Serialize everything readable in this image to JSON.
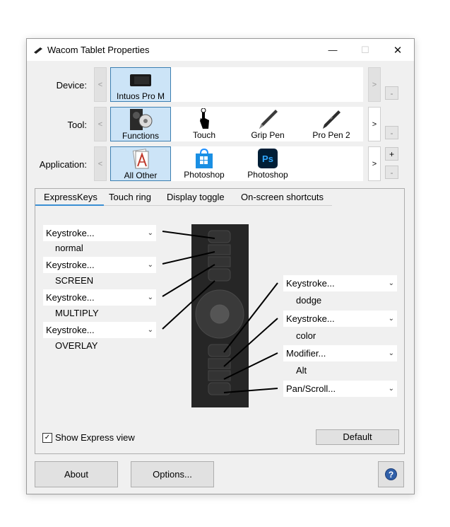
{
  "window": {
    "title": "Wacom Tablet Properties"
  },
  "titlebar": {
    "minimize": "—",
    "maximize": "☐",
    "close": "✕"
  },
  "rows": {
    "device": {
      "label": "Device:",
      "prev": "<",
      "next": ">",
      "minus": "-",
      "tiles": [
        {
          "label": "Intuos Pro M",
          "icon": "tablet-icon"
        }
      ]
    },
    "tool": {
      "label": "Tool:",
      "prev": "<",
      "next": ">",
      "minus": "-",
      "tiles": [
        {
          "label": "Functions",
          "icon": "functions-icon"
        },
        {
          "label": "Touch",
          "icon": "touch-hand-icon"
        },
        {
          "label": "Grip Pen",
          "icon": "grip-pen-icon"
        },
        {
          "label": "Pro Pen 2",
          "icon": "pro-pen-icon"
        }
      ]
    },
    "application": {
      "label": "Application:",
      "prev": "<",
      "next": ">",
      "plus": "+",
      "minus": "-",
      "tiles": [
        {
          "label": "All Other",
          "icon": "all-other-apps-icon"
        },
        {
          "label": "Photoshop",
          "icon": "windows-store-photoshop-icon"
        },
        {
          "label": "Photoshop",
          "icon": "photoshop-icon"
        }
      ]
    }
  },
  "tabs": [
    "ExpressKeys",
    "Touch ring",
    "Display toggle",
    "On-screen shortcuts"
  ],
  "left_keys": [
    {
      "value": "Keystroke...",
      "sub": "normal"
    },
    {
      "value": "Keystroke...",
      "sub": "SCREEN"
    },
    {
      "value": "Keystroke...",
      "sub": "MULTIPLY"
    },
    {
      "value": "Keystroke...",
      "sub": "OVERLAY"
    }
  ],
  "right_keys": [
    {
      "value": "Keystroke...",
      "sub": "dodge"
    },
    {
      "value": "Keystroke...",
      "sub": "color"
    },
    {
      "value": "Modifier...",
      "sub": "Alt"
    },
    {
      "value": "Pan/Scroll...",
      "sub": ""
    }
  ],
  "show_express_view": {
    "label": "Show Express view",
    "checked": true
  },
  "buttons": {
    "default": "Default",
    "about": "About",
    "options": "Options...",
    "help": "?"
  },
  "colors": {
    "accent": "#3a8fd4",
    "selected_tile": "#cce4f7",
    "tablet": "#262626",
    "photoshop": "#001e36",
    "photoshop_text": "#31a8ff"
  }
}
